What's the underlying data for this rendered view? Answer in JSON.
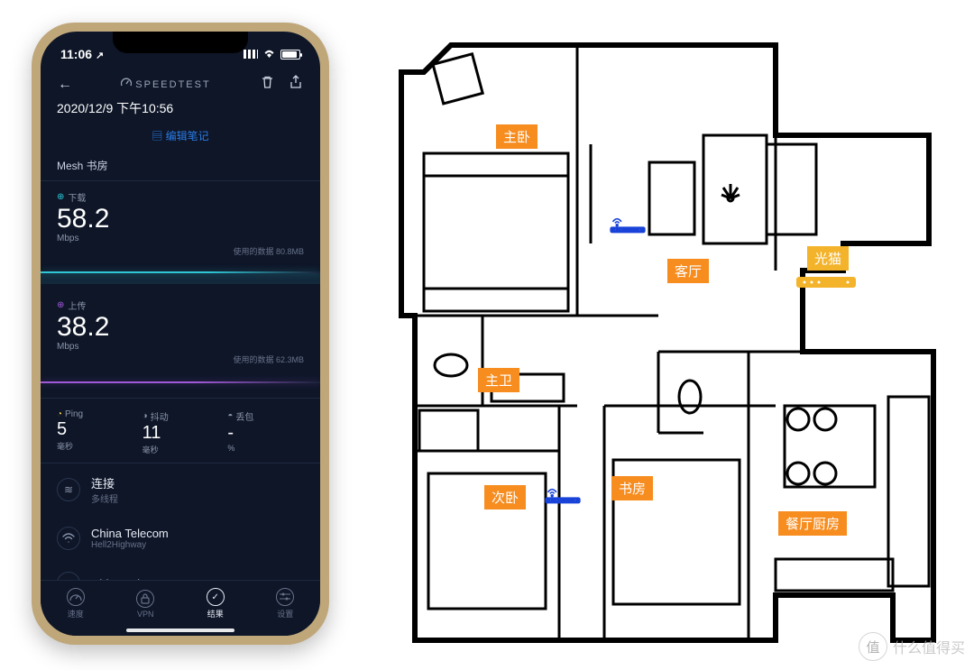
{
  "status": {
    "time": "11:06",
    "nav_icon": "↗"
  },
  "header": {
    "back_icon": "←",
    "title": "SPEEDTEST",
    "trash_icon": "🗑",
    "share_icon": "⇪"
  },
  "timestamp": "2020/12/9 下午10:56",
  "edit_note": "编辑笔记",
  "network_name": "Mesh 书房",
  "download": {
    "label": "下载",
    "value": "58.2",
    "unit": "Mbps",
    "data_used_label": "使用的数据",
    "data_used": "80.8MB"
  },
  "upload": {
    "label": "上传",
    "value": "38.2",
    "unit": "Mbps",
    "data_used_label": "使用的数据",
    "data_used": "62.3MB"
  },
  "ping": {
    "label": "Ping",
    "value": "5",
    "unit": "毫秒"
  },
  "jitter": {
    "label": "抖动",
    "value": "11",
    "unit": "毫秒"
  },
  "loss": {
    "label": "丢包",
    "value": "-",
    "unit": "%"
  },
  "conn": {
    "title": "连接",
    "sub": "多线程"
  },
  "isp1": {
    "title": "China Telecom",
    "sub": "Hell2Highway"
  },
  "isp2": {
    "title": "China Telecom",
    "sub": ""
  },
  "tabs": {
    "speed": "速度",
    "vpn": "VPN",
    "results": "结果",
    "settings": "设置"
  },
  "rooms": {
    "master_bedroom": "主卧",
    "living_room": "客厅",
    "modem": "光猫",
    "master_bath": "主卫",
    "second_bedroom": "次卧",
    "study": "书房",
    "kitchen_dining": "餐厅厨房"
  },
  "watermark": "什么值得买"
}
